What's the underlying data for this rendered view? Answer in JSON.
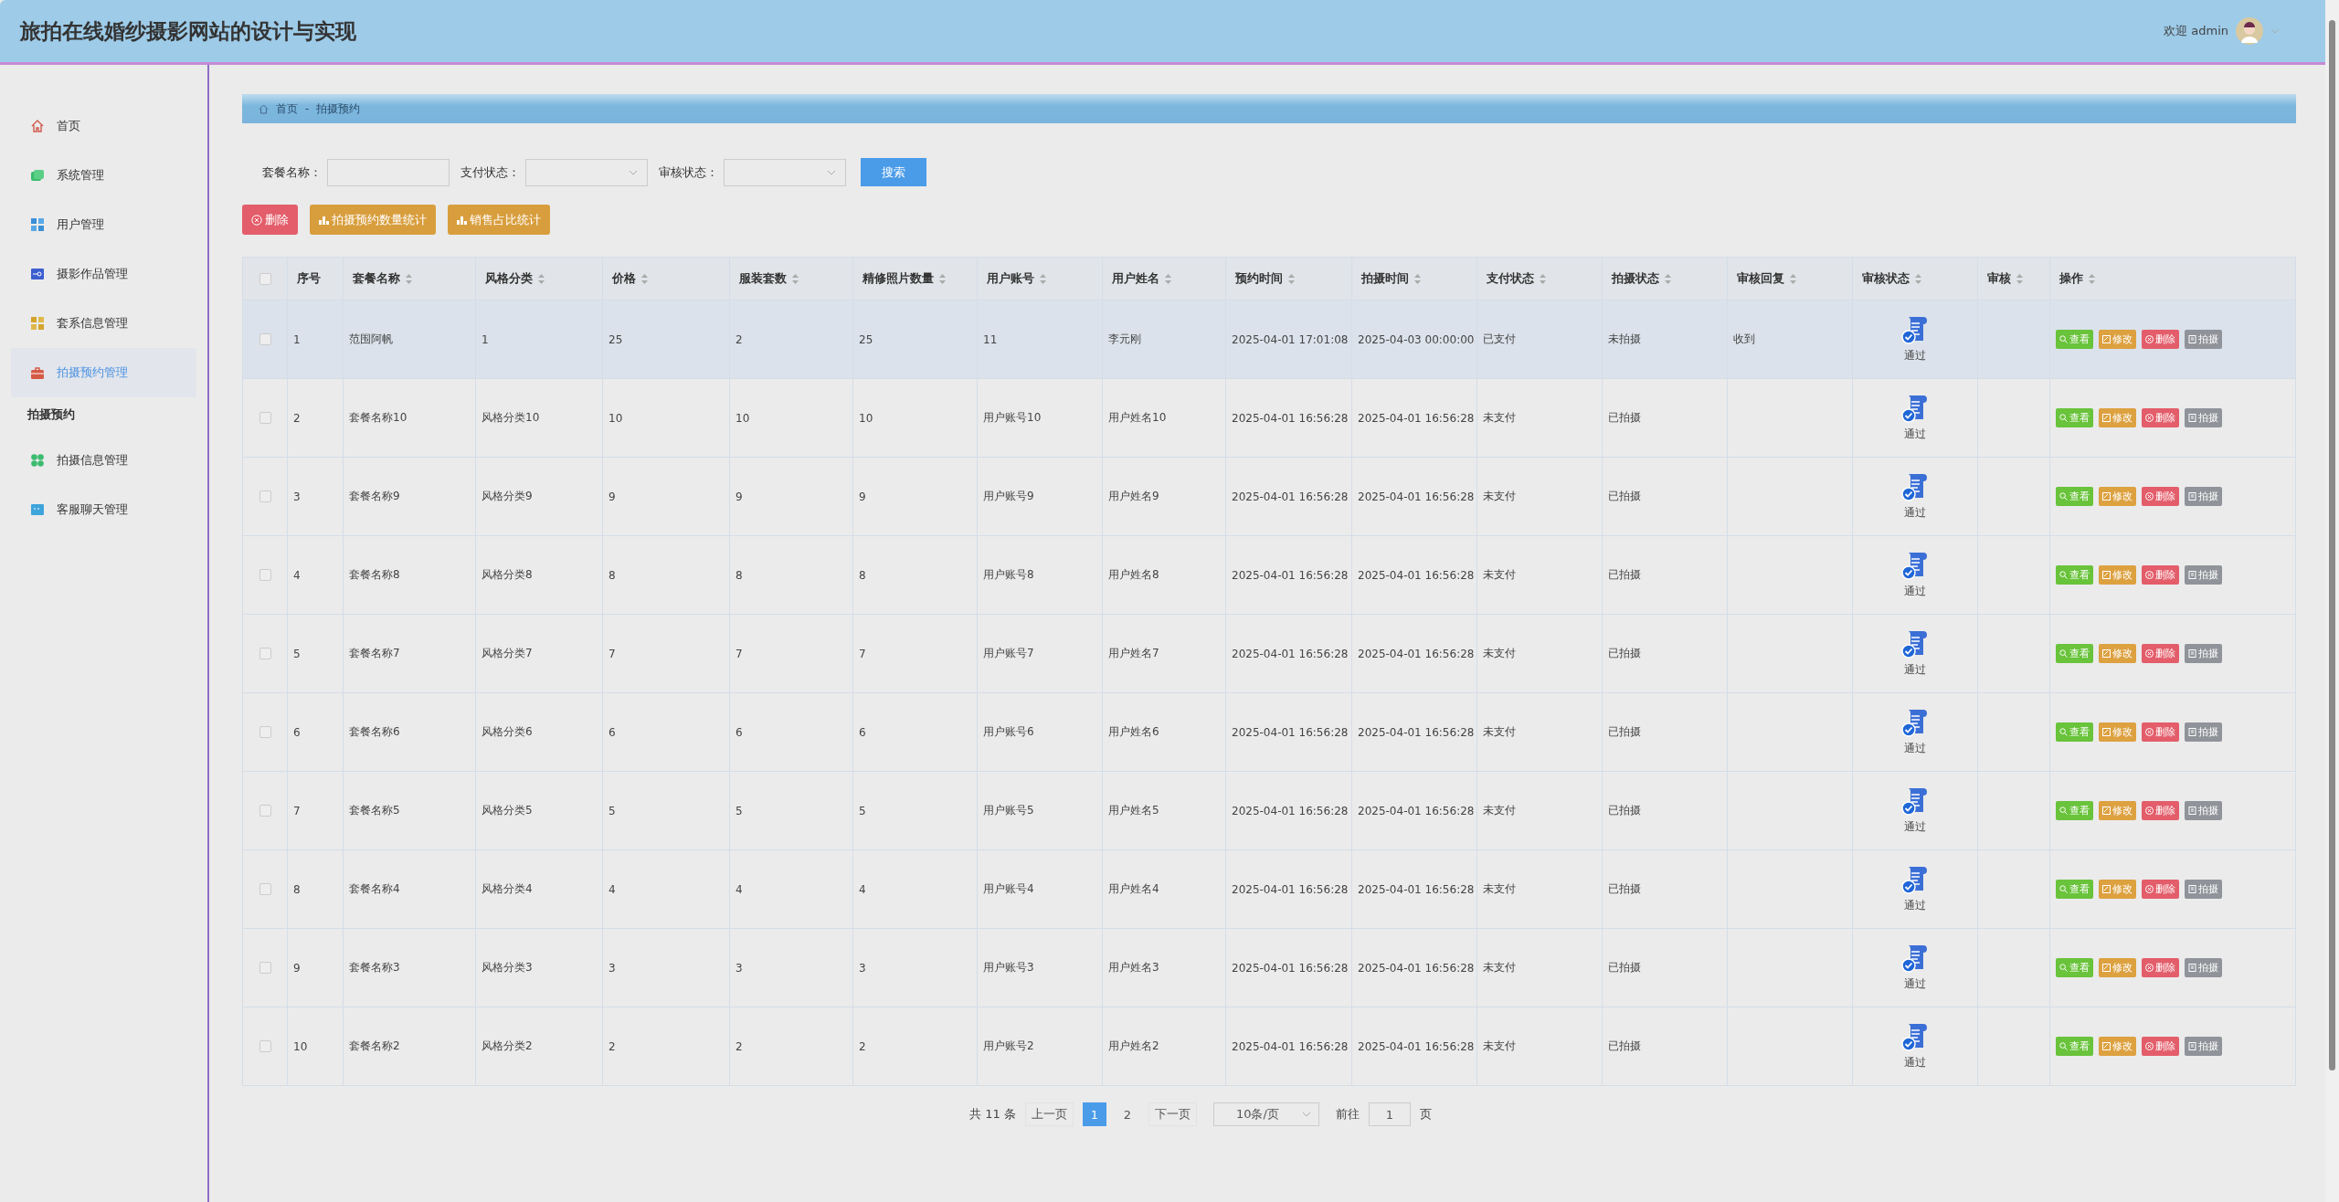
{
  "header": {
    "title": "旅拍在线婚纱摄影网站的设计与实现",
    "greeting": "欢迎 admin"
  },
  "sidebar": {
    "items": [
      {
        "kind": "link",
        "label": "首页",
        "selected": false
      },
      {
        "kind": "link",
        "label": "系统管理",
        "selected": false
      },
      {
        "kind": "link",
        "label": "用户管理",
        "selected": false
      },
      {
        "kind": "link",
        "label": "摄影作品管理",
        "selected": false
      },
      {
        "kind": "link",
        "label": "套系信息管理",
        "selected": false
      },
      {
        "kind": "link",
        "label": "拍摄预约管理",
        "selected": true
      },
      {
        "kind": "heading",
        "label": "拍摄预约"
      },
      {
        "kind": "link",
        "label": "拍摄信息管理",
        "selected": false
      },
      {
        "kind": "link",
        "label": "客服聊天管理",
        "selected": false
      }
    ]
  },
  "breadcrumb": {
    "items": [
      "首页",
      "拍摄预约"
    ],
    "separator": "-"
  },
  "filters": [
    {
      "kind": "input",
      "label": "套餐名称："
    },
    {
      "kind": "select",
      "label": "支付状态："
    },
    {
      "kind": "select",
      "label": "审核状态："
    }
  ],
  "search_button": "搜索",
  "action_buttons": [
    {
      "kind": "danger",
      "label": "删除"
    },
    {
      "kind": "stat",
      "label": "拍摄预约数量统计"
    },
    {
      "kind": "stat",
      "label": "销售占比统计"
    }
  ],
  "table": {
    "all_checked": false,
    "columns": [
      {
        "label": "序号",
        "sortable": false
      },
      {
        "label": "套餐名称",
        "sortable": true
      },
      {
        "label": "风格分类",
        "sortable": true
      },
      {
        "label": "价格",
        "sortable": true
      },
      {
        "label": "服装套数",
        "sortable": true
      },
      {
        "label": "精修照片数量",
        "sortable": true
      },
      {
        "label": "用户账号",
        "sortable": true
      },
      {
        "label": "用户姓名",
        "sortable": true
      },
      {
        "label": "预约时间",
        "sortable": true
      },
      {
        "label": "拍摄时间",
        "sortable": true
      },
      {
        "label": "支付状态",
        "sortable": true
      },
      {
        "label": "拍摄状态",
        "sortable": true
      },
      {
        "label": "审核回复",
        "sortable": true
      },
      {
        "label": "审核状态",
        "sortable": true
      },
      {
        "label": "审核",
        "sortable": true
      },
      {
        "label": "操作",
        "sortable": true
      }
    ],
    "rows": [
      {
        "checked": false,
        "hovered": true,
        "cells": [
          "1",
          "范围阿帆",
          "1",
          "25",
          "2",
          "25",
          "11",
          "李元刚",
          "2025-04-01 17:01:08",
          "2025-04-03 00:00:00",
          "已支付",
          "未拍摄"
        ],
        "reply": "收到",
        "audit": "通过",
        "actions": [
          "查看",
          "修改",
          "删除",
          "拍摄"
        ]
      },
      {
        "checked": false,
        "hovered": false,
        "cells": [
          "2",
          "套餐名称10",
          "风格分类10",
          "10",
          "10",
          "10",
          "用户账号10",
          "用户姓名10",
          "2025-04-01 16:56:28",
          "2025-04-01 16:56:28",
          "未支付",
          "已拍摄"
        ],
        "audit": "通过",
        "actions": [
          "查看",
          "修改",
          "删除",
          "拍摄"
        ]
      },
      {
        "checked": false,
        "hovered": false,
        "cells": [
          "3",
          "套餐名称9",
          "风格分类9",
          "9",
          "9",
          "9",
          "用户账号9",
          "用户姓名9",
          "2025-04-01 16:56:28",
          "2025-04-01 16:56:28",
          "未支付",
          "已拍摄"
        ],
        "audit": "通过",
        "actions": [
          "查看",
          "修改",
          "删除",
          "拍摄"
        ]
      },
      {
        "checked": false,
        "hovered": false,
        "cells": [
          "4",
          "套餐名称8",
          "风格分类8",
          "8",
          "8",
          "8",
          "用户账号8",
          "用户姓名8",
          "2025-04-01 16:56:28",
          "2025-04-01 16:56:28",
          "未支付",
          "已拍摄"
        ],
        "audit": "通过",
        "actions": [
          "查看",
          "修改",
          "删除",
          "拍摄"
        ]
      },
      {
        "checked": false,
        "hovered": false,
        "cells": [
          "5",
          "套餐名称7",
          "风格分类7",
          "7",
          "7",
          "7",
          "用户账号7",
          "用户姓名7",
          "2025-04-01 16:56:28",
          "2025-04-01 16:56:28",
          "未支付",
          "已拍摄"
        ],
        "audit": "通过",
        "actions": [
          "查看",
          "修改",
          "删除",
          "拍摄"
        ]
      },
      {
        "checked": false,
        "hovered": false,
        "cells": [
          "6",
          "套餐名称6",
          "风格分类6",
          "6",
          "6",
          "6",
          "用户账号6",
          "用户姓名6",
          "2025-04-01 16:56:28",
          "2025-04-01 16:56:28",
          "未支付",
          "已拍摄"
        ],
        "audit": "通过",
        "actions": [
          "查看",
          "修改",
          "删除",
          "拍摄"
        ]
      },
      {
        "checked": false,
        "hovered": false,
        "cells": [
          "7",
          "套餐名称5",
          "风格分类5",
          "5",
          "5",
          "5",
          "用户账号5",
          "用户姓名5",
          "2025-04-01 16:56:28",
          "2025-04-01 16:56:28",
          "未支付",
          "已拍摄"
        ],
        "audit": "通过",
        "actions": [
          "查看",
          "修改",
          "删除",
          "拍摄"
        ]
      },
      {
        "checked": false,
        "hovered": false,
        "cells": [
          "8",
          "套餐名称4",
          "风格分类4",
          "4",
          "4",
          "4",
          "用户账号4",
          "用户姓名4",
          "2025-04-01 16:56:28",
          "2025-04-01 16:56:28",
          "未支付",
          "已拍摄"
        ],
        "audit": "通过",
        "actions": [
          "查看",
          "修改",
          "删除",
          "拍摄"
        ]
      },
      {
        "checked": false,
        "hovered": false,
        "cells": [
          "9",
          "套餐名称3",
          "风格分类3",
          "3",
          "3",
          "3",
          "用户账号3",
          "用户姓名3",
          "2025-04-01 16:56:28",
          "2025-04-01 16:56:28",
          "未支付",
          "已拍摄"
        ],
        "audit": "通过",
        "actions": [
          "查看",
          "修改",
          "删除",
          "拍摄"
        ]
      },
      {
        "checked": false,
        "hovered": false,
        "cells": [
          "10",
          "套餐名称2",
          "风格分类2",
          "2",
          "2",
          "2",
          "用户账号2",
          "用户姓名2",
          "2025-04-01 16:56:28",
          "2025-04-01 16:56:28",
          "未支付",
          "已拍摄"
        ],
        "audit": "通过",
        "actions": [
          "查看",
          "修改",
          "删除",
          "拍摄"
        ]
      }
    ]
  },
  "pagination": {
    "total": "共 11 条",
    "prev": "上一页",
    "pages": [
      {
        "label": "1",
        "selected": true
      },
      {
        "label": "2",
        "selected": false
      }
    ],
    "next": "下一页",
    "page_size": "10条/页",
    "goto_label": "前往",
    "goto_value": "1",
    "goto_suffix": "页"
  }
}
